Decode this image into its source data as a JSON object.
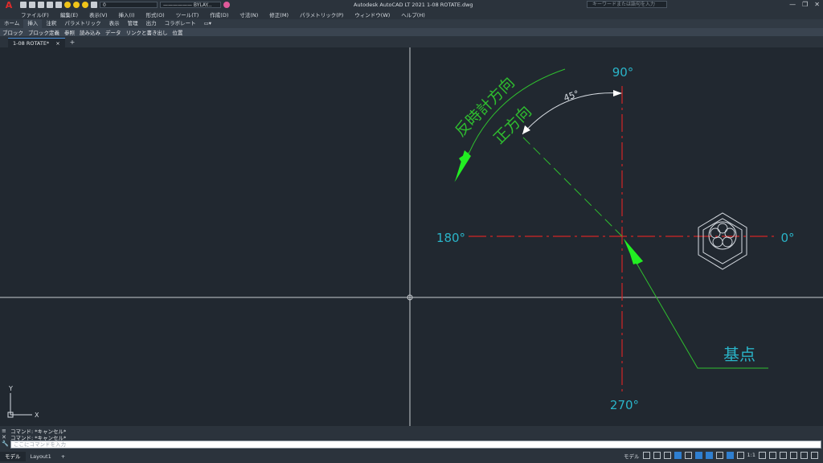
{
  "titlebar": {
    "logo": "A",
    "layer_combo": "0",
    "linetype_combo": "—————— BYLAY...",
    "title": "Autodesk AutoCAD LT 2021    1-08 ROTATE.dwg",
    "search_placeholder": "キーワードまたは語句を入力",
    "window_controls": [
      "—",
      "❐",
      "✕"
    ]
  },
  "menu": [
    "ファイル(F)",
    "編集(E)",
    "表示(V)",
    "挿入(I)",
    "形式(O)",
    "ツール(T)",
    "作成(D)",
    "寸法(N)",
    "修正(M)",
    "パラメトリック(P)",
    "ウィンドウ(W)",
    "ヘルプ(H)"
  ],
  "ribbon_tabs": [
    "ホーム",
    "挿入",
    "注釈",
    "パラメトリック",
    "表示",
    "管理",
    "出力",
    "コラボレート"
  ],
  "ribbon_active_tab": "挿入",
  "ribbon_panels": [
    "ブロック",
    "ブロック定義",
    "参照",
    "読み込み",
    "データ",
    "リンクと書き出し",
    "位置"
  ],
  "document_tab": {
    "label": "1-08 ROTATE*",
    "close": "×",
    "new": "+"
  },
  "drawing": {
    "angle_90": "90°",
    "angle_180": "180°",
    "angle_0": "0°",
    "angle_270": "270°",
    "angle_45": "45°",
    "ccw_label": "反時計方向",
    "positive_label": "正方向",
    "base_point_label": "基点",
    "ucs_y": "Y",
    "ucs_x": "X"
  },
  "command": {
    "history": [
      "コマンド: *キャンセル*",
      "コマンド: *キャンセル*"
    ],
    "placeholder": "ここにコマンドを入力"
  },
  "layout_tabs": [
    "モデル",
    "Layout1"
  ],
  "layout_new": "+",
  "status": {
    "scale": "1:1"
  },
  "colors": {
    "canvas": "#212830",
    "axis_red": "#d42525",
    "cyan_text": "#2ab4c8",
    "green_annotation": "#2fbf2f",
    "bright_green": "#22ee22"
  }
}
